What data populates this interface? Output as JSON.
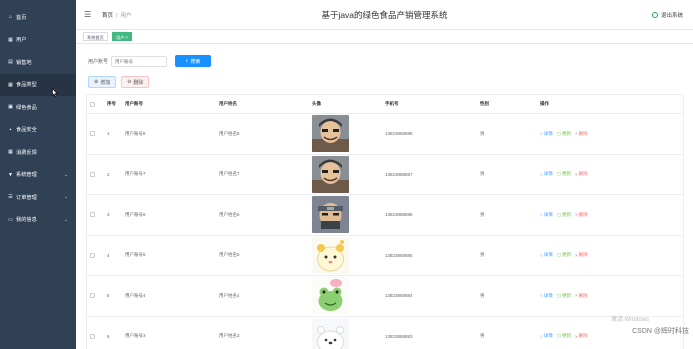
{
  "sidebar": {
    "items": [
      {
        "label": "首页",
        "icon": "home-icon",
        "glyph": "⌂",
        "active": false,
        "expandable": false
      },
      {
        "label": "用户",
        "icon": "grid-icon",
        "glyph": "▦",
        "active": false,
        "expandable": false
      },
      {
        "label": "销售地",
        "icon": "chart-icon",
        "glyph": "▤",
        "active": false,
        "expandable": false
      },
      {
        "label": "食品类型",
        "icon": "grid-icon",
        "glyph": "▦",
        "active": true,
        "expandable": false
      },
      {
        "label": "绿色食品",
        "icon": "folder-icon",
        "glyph": "▣",
        "active": false,
        "expandable": false
      },
      {
        "label": "食品安全",
        "icon": "bag-icon",
        "glyph": "▪",
        "active": false,
        "expandable": false
      },
      {
        "label": "消费反馈",
        "icon": "grid-icon",
        "glyph": "▦",
        "active": false,
        "expandable": false
      },
      {
        "label": "系统管理",
        "icon": "filter-icon",
        "glyph": "▼",
        "active": false,
        "expandable": true
      },
      {
        "label": "订单管理",
        "icon": "list-icon",
        "glyph": "☰",
        "active": false,
        "expandable": true
      },
      {
        "label": "我的信息",
        "icon": "user-card-icon",
        "glyph": "▭",
        "active": false,
        "expandable": true
      }
    ]
  },
  "header": {
    "breadcrumb_home": "首页",
    "breadcrumb_sep": "/",
    "breadcrumb_current": "用户",
    "title": "基于java的绿色食品产销管理系统",
    "logout": "退出系统"
  },
  "tags": {
    "home": "系统首页",
    "current": "用户 ×"
  },
  "search": {
    "label": "用户账号",
    "placeholder": "用户账号",
    "button": "搜索"
  },
  "actions": {
    "add": "增加",
    "delete": "删除"
  },
  "table": {
    "headers": [
      "序号",
      "用户账号",
      "用户姓名",
      "头像",
      "手机号",
      "性别",
      "操作"
    ],
    "ops": {
      "detail": "详情",
      "update": "更新",
      "delete": "删除"
    },
    "rows": [
      {
        "index": "1",
        "account": "用户账号8",
        "name": "用户姓名8",
        "avatar": "avatar-pirate",
        "phone": "13823888888",
        "sex": "男"
      },
      {
        "index": "2",
        "account": "用户账号7",
        "name": "用户姓名7",
        "avatar": "avatar-pirate",
        "phone": "13823888887",
        "sex": "男"
      },
      {
        "index": "3",
        "account": "用户账号6",
        "name": "用户姓名6",
        "avatar": "avatar-ninja",
        "phone": "13823888886",
        "sex": "男"
      },
      {
        "index": "4",
        "account": "用户账号5",
        "name": "用户姓名5",
        "avatar": "avatar-hamster",
        "phone": "13823888885",
        "sex": "男"
      },
      {
        "index": "5",
        "account": "用户账号4",
        "name": "用户姓名4",
        "avatar": "avatar-frog",
        "phone": "13823888884",
        "sex": "男"
      },
      {
        "index": "6",
        "account": "用户账号3",
        "name": "用户姓名3",
        "avatar": "avatar-bear",
        "phone": "13823888883",
        "sex": "男"
      }
    ]
  },
  "watermark": {
    "windows": "激活 Windows",
    "csdn": "CSDN @辉时科技"
  },
  "colors": {
    "sidebar": "#304156",
    "primary": "#1890ff",
    "tag_active": "#42b983"
  }
}
